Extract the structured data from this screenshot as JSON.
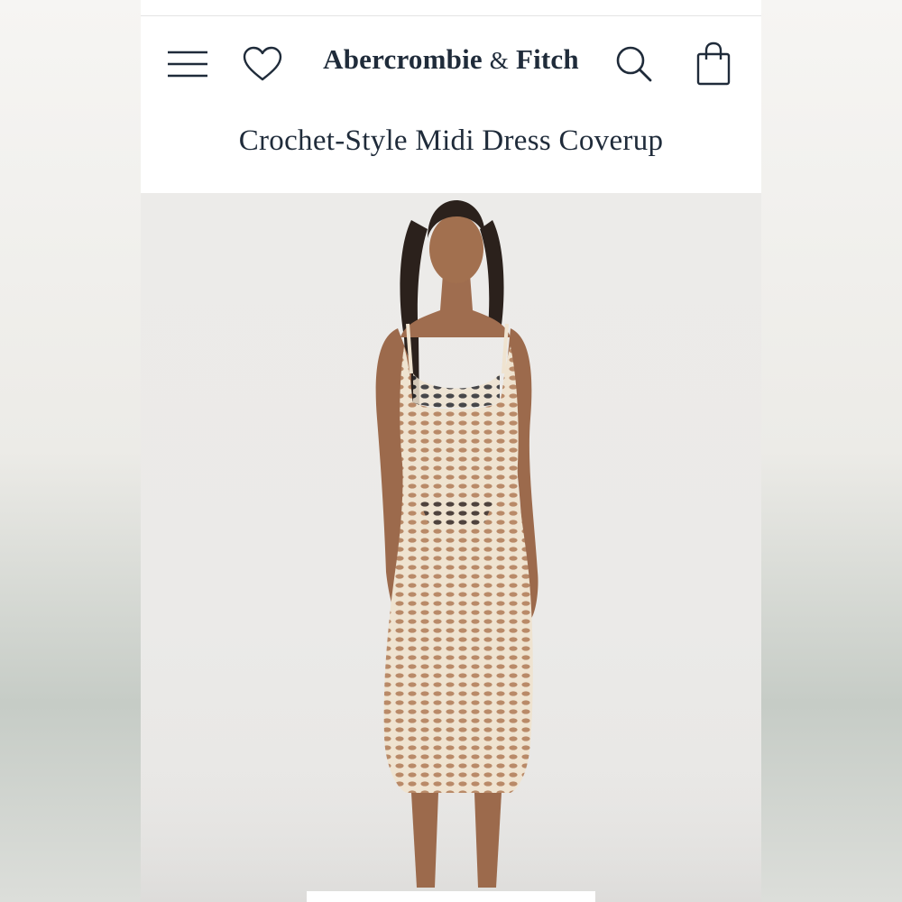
{
  "brand": {
    "name_left": "Abercrombie",
    "ampersand": "&",
    "name_right": "Fitch"
  },
  "product": {
    "title": "Crochet-Style Midi Dress Coverup"
  },
  "icons": {
    "menu": "hamburger-menu-icon",
    "wishlist": "heart-icon",
    "search": "search-icon",
    "bag": "shopping-bag-icon"
  },
  "colors": {
    "brand_navy": "#1f2b3a",
    "background": "#ffffff",
    "photo_backdrop": "#ebeae8",
    "dress": "#efe3d0"
  }
}
